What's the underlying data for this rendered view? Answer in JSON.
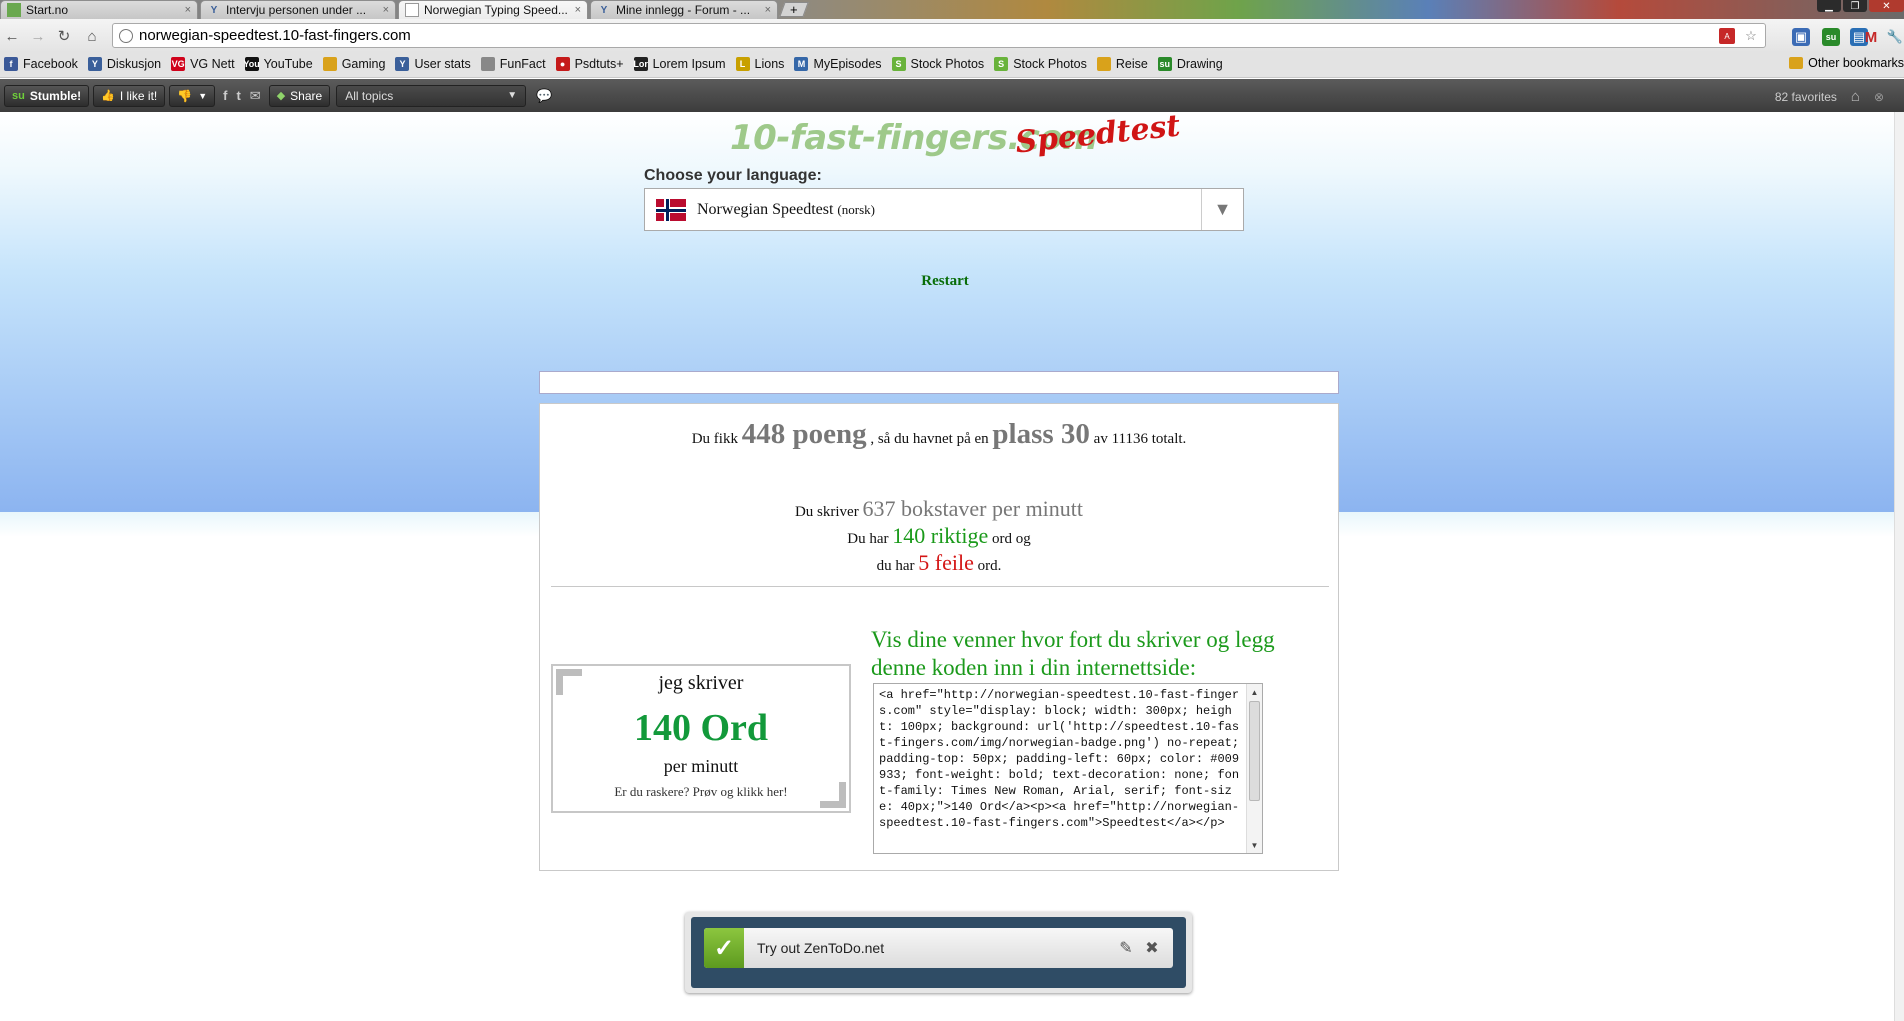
{
  "browser": {
    "tabs": [
      {
        "title": "Start.no",
        "icon": "start-icon",
        "color": "#6aa84f"
      },
      {
        "title": "Intervju personen under ...",
        "icon": "forum-y-icon",
        "color": "#3a5f9a"
      },
      {
        "title": "Norwegian Typing Speed...",
        "icon": "page-icon",
        "color": "#ffffff"
      },
      {
        "title": "Mine innlegg - Forum - ...",
        "icon": "forum-y-icon",
        "color": "#3a5f9a"
      }
    ],
    "tab_close": "×",
    "new_tab": "+",
    "url": "norwegian-speedtest.10-fast-fingers.com"
  },
  "bookmarks": {
    "items": [
      {
        "label": "Facebook",
        "icon": "facebook-icon",
        "color": "#3b5998",
        "glyph": "f"
      },
      {
        "label": "Diskusjon",
        "icon": "forum-y-icon",
        "color": "#3a5f9a",
        "glyph": "Y"
      },
      {
        "label": "VG Nett",
        "icon": "vg-icon",
        "color": "#d0021b",
        "glyph": "VG"
      },
      {
        "label": "YouTube",
        "icon": "youtube-icon",
        "color": "#111111",
        "glyph": "You"
      },
      {
        "label": "Gaming",
        "icon": "folder-icon",
        "color": "#d9a21b",
        "glyph": ""
      },
      {
        "label": "User stats",
        "icon": "forum-y-icon",
        "color": "#3a5f9a",
        "glyph": "Y"
      },
      {
        "label": "FunFact",
        "icon": "page-icon",
        "color": "#888888",
        "glyph": ""
      },
      {
        "label": "Psdtuts+",
        "icon": "psdtuts-icon",
        "color": "#c51a1a",
        "glyph": "●"
      },
      {
        "label": "Lorem Ipsum",
        "icon": "lorem-icon",
        "color": "#222222",
        "glyph": "Lor"
      },
      {
        "label": "Lions",
        "icon": "lions-icon",
        "color": "#c8a000",
        "glyph": "L"
      },
      {
        "label": "MyEpisodes",
        "icon": "myepisodes-icon",
        "color": "#3567a8",
        "glyph": "M"
      },
      {
        "label": "Stock Photos",
        "icon": "stockphoto-icon",
        "color": "#69b33b",
        "glyph": "S"
      },
      {
        "label": "Stock Photos",
        "icon": "stockphoto-icon",
        "color": "#69b33b",
        "glyph": "S"
      },
      {
        "label": "Reise",
        "icon": "folder-icon",
        "color": "#d9a21b",
        "glyph": ""
      },
      {
        "label": "Drawing",
        "icon": "stumbleupon-icon",
        "color": "#2a8a2a",
        "glyph": "su"
      }
    ],
    "other": "Other bookmarks"
  },
  "stumblebar": {
    "stumble": "Stumble!",
    "like": "I like it!",
    "share": "Share",
    "topics": "All topics",
    "favorites": "82 favorites"
  },
  "site": {
    "logo_main": "10-fast-fingers.com",
    "logo_sub": "Speedtest",
    "choose_language": "Choose your language:",
    "language": "Norwegian Speedtest",
    "language_native": "(norsk)",
    "restart": "Restart"
  },
  "results": {
    "du_fikk": "Du fikk",
    "points": "448 poeng",
    "havnet": ", så du havnet på en",
    "place": "plass 30",
    "total": "av 11136 totalt.",
    "du_skriver": "Du skriver",
    "chars": "637 bokstaver per minutt",
    "du_har": "Du har",
    "correct": "140 riktige",
    "ord_og": "ord og",
    "du_har2": "du har",
    "wrong": "5 feile",
    "ord": "ord."
  },
  "badge": {
    "line1": "jeg skriver",
    "words": "140 Ord",
    "line3": "per minutt",
    "line4": "Er du raskere? Prøv og klikk her!"
  },
  "share": {
    "heading": "Vis dine venner hvor fort du skriver og legg denne koden inn i din internettside:",
    "code": "<a href=\"http://norwegian-speedtest.10-fast-fingers.com\" style=\"display: block; width: 300px; height: 100px; background: url('http://speedtest.10-fast-fingers.com/img/norwegian-badge.png') no-repeat; padding-top: 50px; padding-left: 60px; color: #009933; font-weight: bold; text-decoration: none; font-family: Times New Roman, Arial, serif; font-size: 40px;\">140 Ord</a><p><a href=\"http://norwegian-speedtest.10-fast-fingers.com\">Speedtest</a></p>"
  },
  "zentodo": {
    "text": "Try out ZenToDo.net"
  }
}
